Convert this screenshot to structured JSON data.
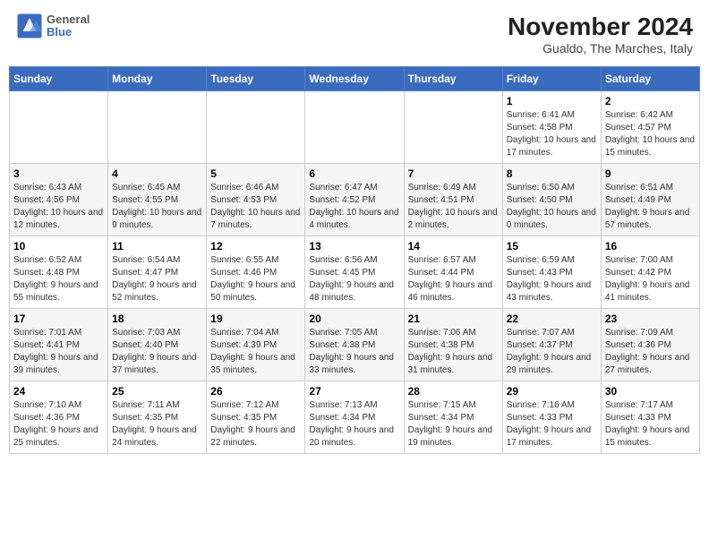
{
  "header": {
    "logo": {
      "general": "General",
      "blue": "Blue"
    },
    "month_title": "November 2024",
    "location": "Gualdo, The Marches, Italy"
  },
  "weekdays": [
    "Sunday",
    "Monday",
    "Tuesday",
    "Wednesday",
    "Thursday",
    "Friday",
    "Saturday"
  ],
  "weeks": [
    [
      {
        "day": "",
        "info": ""
      },
      {
        "day": "",
        "info": ""
      },
      {
        "day": "",
        "info": ""
      },
      {
        "day": "",
        "info": ""
      },
      {
        "day": "",
        "info": ""
      },
      {
        "day": "1",
        "info": "Sunrise: 6:41 AM\nSunset: 4:58 PM\nDaylight: 10 hours and 17 minutes."
      },
      {
        "day": "2",
        "info": "Sunrise: 6:42 AM\nSunset: 4:57 PM\nDaylight: 10 hours and 15 minutes."
      }
    ],
    [
      {
        "day": "3",
        "info": "Sunrise: 6:43 AM\nSunset: 4:56 PM\nDaylight: 10 hours and 12 minutes."
      },
      {
        "day": "4",
        "info": "Sunrise: 6:45 AM\nSunset: 4:55 PM\nDaylight: 10 hours and 9 minutes."
      },
      {
        "day": "5",
        "info": "Sunrise: 6:46 AM\nSunset: 4:53 PM\nDaylight: 10 hours and 7 minutes."
      },
      {
        "day": "6",
        "info": "Sunrise: 6:47 AM\nSunset: 4:52 PM\nDaylight: 10 hours and 4 minutes."
      },
      {
        "day": "7",
        "info": "Sunrise: 6:49 AM\nSunset: 4:51 PM\nDaylight: 10 hours and 2 minutes."
      },
      {
        "day": "8",
        "info": "Sunrise: 6:50 AM\nSunset: 4:50 PM\nDaylight: 10 hours and 0 minutes."
      },
      {
        "day": "9",
        "info": "Sunrise: 6:51 AM\nSunset: 4:49 PM\nDaylight: 9 hours and 57 minutes."
      }
    ],
    [
      {
        "day": "10",
        "info": "Sunrise: 6:52 AM\nSunset: 4:48 PM\nDaylight: 9 hours and 55 minutes."
      },
      {
        "day": "11",
        "info": "Sunrise: 6:54 AM\nSunset: 4:47 PM\nDaylight: 9 hours and 52 minutes."
      },
      {
        "day": "12",
        "info": "Sunrise: 6:55 AM\nSunset: 4:46 PM\nDaylight: 9 hours and 50 minutes."
      },
      {
        "day": "13",
        "info": "Sunrise: 6:56 AM\nSunset: 4:45 PM\nDaylight: 9 hours and 48 minutes."
      },
      {
        "day": "14",
        "info": "Sunrise: 6:57 AM\nSunset: 4:44 PM\nDaylight: 9 hours and 46 minutes."
      },
      {
        "day": "15",
        "info": "Sunrise: 6:59 AM\nSunset: 4:43 PM\nDaylight: 9 hours and 43 minutes."
      },
      {
        "day": "16",
        "info": "Sunrise: 7:00 AM\nSunset: 4:42 PM\nDaylight: 9 hours and 41 minutes."
      }
    ],
    [
      {
        "day": "17",
        "info": "Sunrise: 7:01 AM\nSunset: 4:41 PM\nDaylight: 9 hours and 39 minutes."
      },
      {
        "day": "18",
        "info": "Sunrise: 7:03 AM\nSunset: 4:40 PM\nDaylight: 9 hours and 37 minutes."
      },
      {
        "day": "19",
        "info": "Sunrise: 7:04 AM\nSunset: 4:39 PM\nDaylight: 9 hours and 35 minutes."
      },
      {
        "day": "20",
        "info": "Sunrise: 7:05 AM\nSunset: 4:38 PM\nDaylight: 9 hours and 33 minutes."
      },
      {
        "day": "21",
        "info": "Sunrise: 7:06 AM\nSunset: 4:38 PM\nDaylight: 9 hours and 31 minutes."
      },
      {
        "day": "22",
        "info": "Sunrise: 7:07 AM\nSunset: 4:37 PM\nDaylight: 9 hours and 29 minutes."
      },
      {
        "day": "23",
        "info": "Sunrise: 7:09 AM\nSunset: 4:36 PM\nDaylight: 9 hours and 27 minutes."
      }
    ],
    [
      {
        "day": "24",
        "info": "Sunrise: 7:10 AM\nSunset: 4:36 PM\nDaylight: 9 hours and 25 minutes."
      },
      {
        "day": "25",
        "info": "Sunrise: 7:11 AM\nSunset: 4:35 PM\nDaylight: 9 hours and 24 minutes."
      },
      {
        "day": "26",
        "info": "Sunrise: 7:12 AM\nSunset: 4:35 PM\nDaylight: 9 hours and 22 minutes."
      },
      {
        "day": "27",
        "info": "Sunrise: 7:13 AM\nSunset: 4:34 PM\nDaylight: 9 hours and 20 minutes."
      },
      {
        "day": "28",
        "info": "Sunrise: 7:15 AM\nSunset: 4:34 PM\nDaylight: 9 hours and 19 minutes."
      },
      {
        "day": "29",
        "info": "Sunrise: 7:16 AM\nSunset: 4:33 PM\nDaylight: 9 hours and 17 minutes."
      },
      {
        "day": "30",
        "info": "Sunrise: 7:17 AM\nSunset: 4:33 PM\nDaylight: 9 hours and 15 minutes."
      }
    ]
  ]
}
